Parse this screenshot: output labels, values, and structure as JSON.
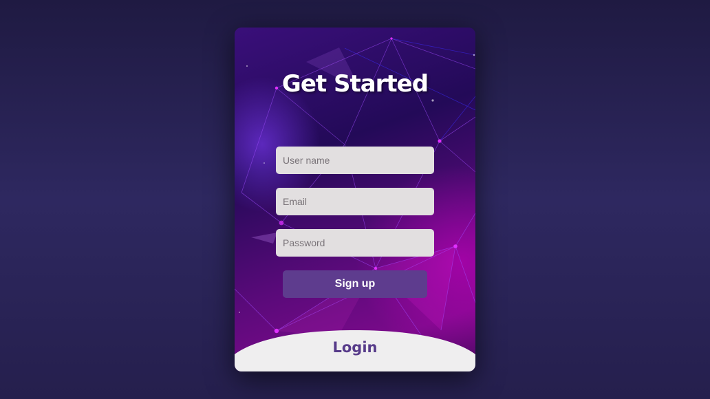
{
  "card": {
    "title": "Get Started"
  },
  "form": {
    "username_placeholder": "User name",
    "email_placeholder": "Email",
    "password_placeholder": "Password",
    "signup_label": "Sign up"
  },
  "login": {
    "label": "Login"
  },
  "colors": {
    "page_background": "#2e2860",
    "card_gradient_start": "#3a0f7a",
    "card_gradient_end": "#7a0a8a",
    "input_background": "#e2dfe0",
    "signup_button": "#5e3c8e",
    "login_panel": "#efeeef",
    "login_text": "#573b8a"
  }
}
